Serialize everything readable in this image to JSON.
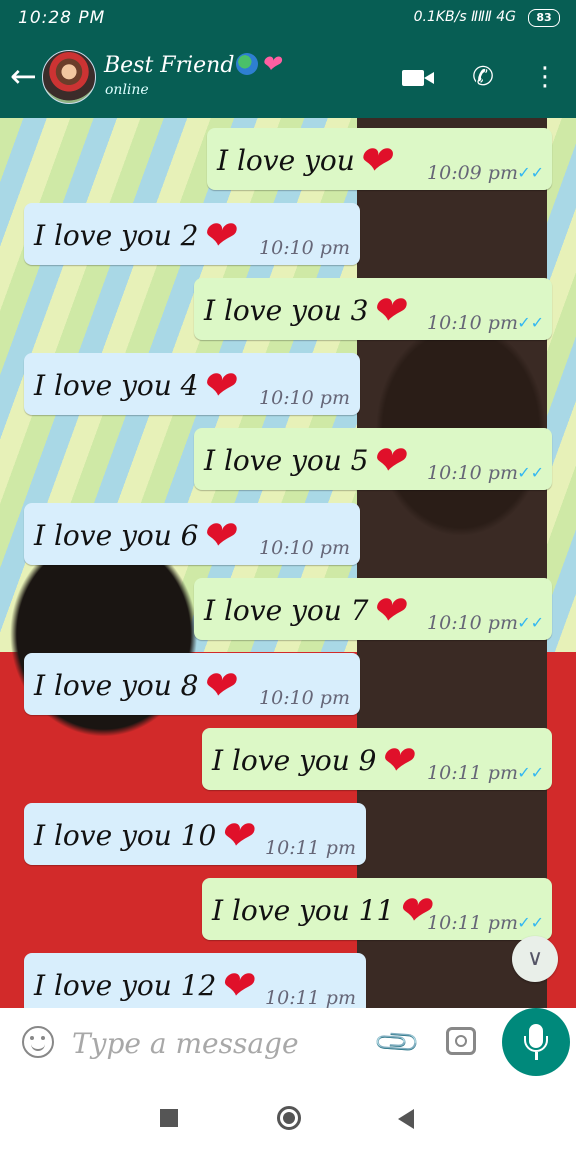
{
  "status_bar": {
    "time": "10:28 PM",
    "network": "0.1KB/s ⅡⅡⅡ 4G",
    "battery": "83"
  },
  "header": {
    "contact_name": "Best Friend",
    "status": "online",
    "icons": [
      "back-arrow-icon",
      "avatar",
      "video-call-icon",
      "phone-icon",
      "more-options-icon"
    ]
  },
  "messages": [
    {
      "direction": "out",
      "text": "I love you",
      "time": "10:09 pm",
      "ticks": "✓✓"
    },
    {
      "direction": "in",
      "text": "I love you 2",
      "time": "10:10 pm"
    },
    {
      "direction": "out",
      "text": "I love you 3",
      "time": "10:10 pm",
      "ticks": "✓✓"
    },
    {
      "direction": "in",
      "text": "I love you 4",
      "time": "10:10 pm"
    },
    {
      "direction": "out",
      "text": "I love you 5",
      "time": "10:10 pm",
      "ticks": "✓✓"
    },
    {
      "direction": "in",
      "text": "I love you 6",
      "time": "10:10 pm"
    },
    {
      "direction": "out",
      "text": "I love you 7",
      "time": "10:10 pm",
      "ticks": "✓✓"
    },
    {
      "direction": "in",
      "text": "I love you 8",
      "time": "10:10 pm"
    },
    {
      "direction": "out",
      "text": "I love you 9",
      "time": "10:11 pm",
      "ticks": "✓✓"
    },
    {
      "direction": "in",
      "text": "I love you 10",
      "time": "10:11 pm"
    },
    {
      "direction": "out",
      "text": "I love you 11",
      "time": "10:11 pm",
      "ticks": "✓✓"
    },
    {
      "direction": "in",
      "text": "I love you 12",
      "time": "10:11 pm"
    }
  ],
  "composer": {
    "placeholder": "Type a message"
  },
  "colors": {
    "header": "#075e54",
    "outgoing_bubble": "#dcf8c6",
    "incoming_bubble": "#d8eefc",
    "read_ticks": "#34b7f1",
    "mic_button": "#00897b"
  }
}
